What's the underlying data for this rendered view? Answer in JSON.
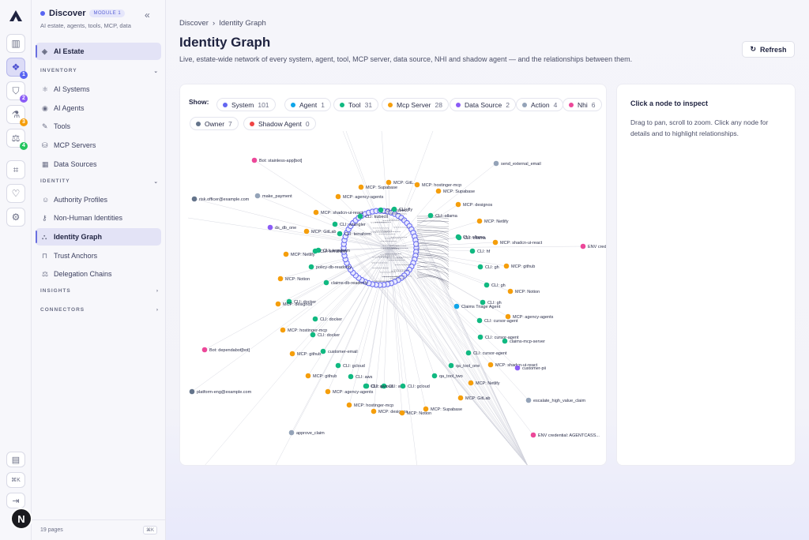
{
  "rail": {
    "items": [
      {
        "icon": "chart-icon"
      },
      {
        "icon": "ai-estate-icon",
        "badge": "1",
        "badge_color": "#5865f2",
        "active": true
      },
      {
        "icon": "shield-icon",
        "badge": "2",
        "badge_color": "#8b5cf6"
      },
      {
        "icon": "flask-icon",
        "badge": "3",
        "badge_color": "#f59e0b"
      },
      {
        "icon": "scale-icon",
        "badge": "4",
        "badge_color": "#22c55e"
      },
      {
        "icon": "scan-icon"
      },
      {
        "icon": "heart-icon"
      },
      {
        "icon": "gear-icon"
      }
    ],
    "bottom": [
      {
        "icon": "book-icon"
      },
      {
        "label": "⌘K"
      },
      {
        "icon": "logout-icon"
      }
    ],
    "avatar": "N"
  },
  "sidebar": {
    "module": "Discover",
    "module_badge": "MODULE 1",
    "module_sub": "AI estate, agents, tools, MCP, data",
    "top_item": "AI Estate",
    "sections": [
      {
        "label": "INVENTORY",
        "items": [
          "AI Systems",
          "AI Agents",
          "Tools",
          "MCP Servers",
          "Data Sources"
        ]
      },
      {
        "label": "IDENTITY",
        "items": [
          "Authority Profiles",
          "Non-Human Identities",
          "Identity Graph",
          "Trust Anchors",
          "Delegation Chains"
        ]
      },
      {
        "label": "INSIGHTS",
        "items": []
      },
      {
        "label": "CONNECTORS",
        "items": []
      }
    ],
    "footer_pages": "19 pages",
    "footer_kbd": "⌘K"
  },
  "header": {
    "breadcrumb": [
      "Discover",
      "Identity Graph"
    ],
    "title": "Identity Graph",
    "description": "Live, estate-wide network of every system, agent, tool, MCP server, data source, NHI and shadow agent — and the relationships between them.",
    "refresh_label": "Refresh"
  },
  "filters": {
    "show_label": "Show:",
    "chips": [
      {
        "label": "System",
        "count": "101",
        "color": "#6366f1"
      },
      {
        "label": "Agent",
        "count": "1",
        "color": "#0ea5e9"
      },
      {
        "label": "Tool",
        "count": "31",
        "color": "#10b981"
      },
      {
        "label": "Mcp Server",
        "count": "28",
        "color": "#f59e0b"
      },
      {
        "label": "Data Source",
        "count": "2",
        "color": "#8b5cf6"
      },
      {
        "label": "Action",
        "count": "4",
        "color": "#94a3b8"
      },
      {
        "label": "Nhi",
        "count": "6",
        "color": "#ec4899"
      },
      {
        "label": "Owner",
        "count": "7",
        "color": "#64748b"
      },
      {
        "label": "Shadow Agent",
        "count": "0",
        "color": "#ef4444"
      }
    ]
  },
  "graph": {
    "colors": {
      "tool": "#10b981",
      "mcp": "#f59e0b",
      "system": "#6366f1",
      "nhi": "#ec4899",
      "owner": "#64748b",
      "action": "#94a3b8",
      "data": "#8b5cf6",
      "agent": "#0ea5e9"
    },
    "nodes": [
      {
        "t": "nhi",
        "label": "Bot: stainless-app[bot]"
      },
      {
        "t": "action",
        "label": "send_external_email"
      },
      {
        "t": "owner",
        "label": "risk.officer@example.com"
      },
      {
        "t": "action",
        "label": "make_payment"
      },
      {
        "t": "mcp",
        "label": "MCP: Supabase"
      },
      {
        "t": "mcp",
        "label": "MCP: GitL.."
      },
      {
        "t": "mcp",
        "label": "MCP: hostinger-mcp"
      },
      {
        "t": "mcp",
        "label": "MCP: Supabase"
      },
      {
        "t": "mcp",
        "label": "MCP: agency-agents"
      },
      {
        "t": "mcp",
        "label": "MCP: designos"
      },
      {
        "t": "mcp",
        "label": "MCP: shadcn-ui-react"
      },
      {
        "t": "tool",
        "label": "CLI: kubectl"
      },
      {
        "t": "tool",
        "label": "CLI: kubectl"
      },
      {
        "t": "tool",
        "label": "CLI: fly"
      },
      {
        "t": "tool",
        "label": "CLI: wrangler"
      },
      {
        "t": "tool",
        "label": "CLI: ollama"
      },
      {
        "t": "mcp",
        "label": "MCP: Netlify"
      },
      {
        "t": "tool",
        "label": "CLI: terraform"
      },
      {
        "t": "tool",
        "label": "CLI: ollama"
      },
      {
        "t": "data",
        "label": "ds_db_one"
      },
      {
        "t": "mcp",
        "label": "MCP: GitLab"
      },
      {
        "t": "tool",
        "label": "CLI: ollama"
      },
      {
        "t": "mcp",
        "label": "MCP: shadcn-ui-react"
      },
      {
        "t": "tool",
        "label": "CLI: terraform"
      },
      {
        "t": "nhi",
        "label": "ENV credential"
      },
      {
        "t": "mcp",
        "label": "MCP: Netlify"
      },
      {
        "t": "tool",
        "label": "CLI: terraform"
      },
      {
        "t": "tool",
        "label": "CLI: hf"
      },
      {
        "t": "tool",
        "label": "policy-db-readonly"
      },
      {
        "t": "tool",
        "label": "CLI: gh"
      },
      {
        "t": "mcp",
        "label": "MCP: github"
      },
      {
        "t": "mcp",
        "label": "MCP: Notion"
      },
      {
        "t": "tool",
        "label": "claims-db-readonly"
      },
      {
        "t": "tool",
        "label": "CLI: gh"
      },
      {
        "t": "mcp",
        "label": "MCP: Notion"
      },
      {
        "t": "tool",
        "label": "CLI: docker"
      },
      {
        "t": "mcp",
        "label": "MCP: designos"
      },
      {
        "t": "tool",
        "label": "CLI: gh"
      },
      {
        "t": "agent",
        "label": "Claims Triage Agent"
      },
      {
        "t": "mcp",
        "label": "MCP: agency-agents"
      },
      {
        "t": "tool",
        "label": "CLI: docker"
      },
      {
        "t": "tool",
        "label": "CLI: cursor-agent"
      },
      {
        "t": "mcp",
        "label": "MCP: hostinger-mcp"
      },
      {
        "t": "tool",
        "label": "CLI: docker"
      },
      {
        "t": "tool",
        "label": "CLI: cursor-agent"
      },
      {
        "t": "tool",
        "label": "claims-mcp-server"
      },
      {
        "t": "nhi",
        "label": "Bot: dependabot[bot]"
      },
      {
        "t": "mcp",
        "label": "MCP: github"
      },
      {
        "t": "tool",
        "label": "customer-email"
      },
      {
        "t": "tool",
        "label": "CLI: cursor-agent"
      },
      {
        "t": "tool",
        "label": "CLI: gcloud"
      },
      {
        "t": "tool",
        "label": "qa_tool_one"
      },
      {
        "t": "mcp",
        "label": "MCP: shadcn-ui-react"
      },
      {
        "t": "data",
        "label": "customer-pii"
      },
      {
        "t": "mcp",
        "label": "MCP: github"
      },
      {
        "t": "tool",
        "label": "CLI: aws"
      },
      {
        "t": "tool",
        "label": "qa_tool_two"
      },
      {
        "t": "tool",
        "label": "CLI: gcloud"
      },
      {
        "t": "mcp",
        "label": "MCP: Netlify"
      },
      {
        "t": "owner",
        "label": "platform-eng@example.com"
      },
      {
        "t": "mcp",
        "label": "MCP: agency-agents"
      },
      {
        "t": "tool",
        "label": "CLI: aws"
      },
      {
        "t": "tool",
        "label": "CLI: gcloud"
      },
      {
        "t": "tool",
        "label": "CLI: aws"
      },
      {
        "t": "mcp",
        "label": "MCP: GitLab"
      },
      {
        "t": "action",
        "label": "escalate_high_value_claim"
      },
      {
        "t": "mcp",
        "label": "MCP: hostinger-mcp"
      },
      {
        "t": "mcp",
        "label": "MCP: designos"
      },
      {
        "t": "mcp",
        "label": "MCP: Supabase"
      },
      {
        "t": "mcp",
        "label": "MCP: Notion"
      },
      {
        "t": "action",
        "label": "approve_claim"
      },
      {
        "t": "nhi",
        "label": "ENV credential: AGENTCASS..."
      }
    ]
  },
  "inspect": {
    "title": "Click a node to inspect",
    "description": "Drag to pan, scroll to zoom. Click any node for details and to highlight relationships."
  }
}
